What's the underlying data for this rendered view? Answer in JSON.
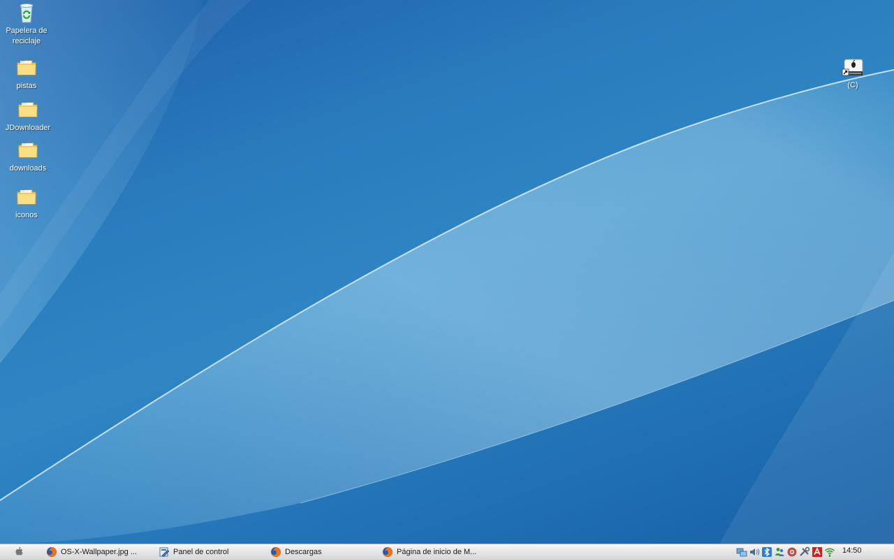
{
  "desktop": {
    "icons_left": [
      {
        "label": "Papelera de reciclaje",
        "icon": "recycle-bin-icon"
      },
      {
        "label": "pistas",
        "icon": "folder-icon"
      },
      {
        "label": "JDownloader",
        "icon": "folder-icon"
      },
      {
        "label": "downloads",
        "icon": "folder-icon"
      },
      {
        "label": "iconos",
        "icon": "folder-icon"
      }
    ],
    "icons_right": [
      {
        "label": "(C)",
        "icon": "drive-shortcut-icon"
      }
    ]
  },
  "taskbar": {
    "start_icon": "apple-icon",
    "tasks": [
      {
        "label": "OS-X-Wallpaper.jpg ...",
        "icon": "firefox-icon"
      },
      {
        "label": "Panel de control",
        "icon": "control-panel-icon"
      },
      {
        "label": "Descargas",
        "icon": "firefox-icon"
      },
      {
        "label": "Página de inicio de M...",
        "icon": "firefox-icon"
      }
    ],
    "tray_icons": [
      "network-icon",
      "volume-icon",
      "bluetooth-icon",
      "messenger-icon",
      "security-icon",
      "tool-icon",
      "antivirus-icon",
      "wifi-icon"
    ],
    "clock": "14:50"
  },
  "colors": {
    "wallpaper_base": "#2a7cbd",
    "taskbar_bg": "#e3e3e3",
    "folder": "#f5d976"
  }
}
